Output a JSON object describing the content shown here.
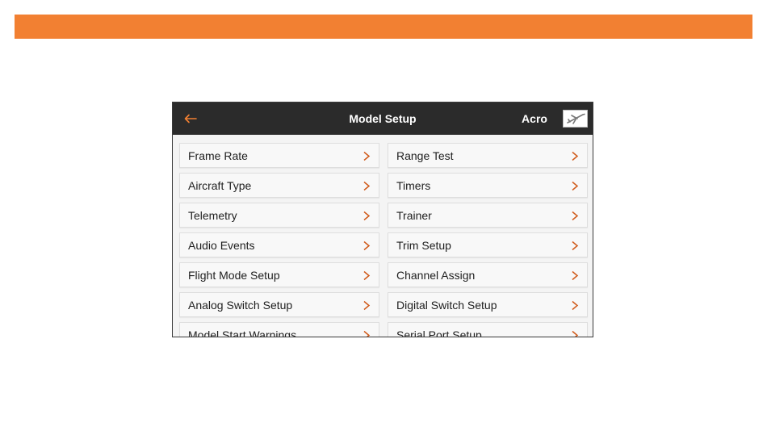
{
  "header": {
    "title": "Model Setup",
    "model_name": "Acro",
    "back_icon": "arrow-left-icon",
    "model_icon": "airplane-icon",
    "accent_color": "#f28032"
  },
  "menu": {
    "left": [
      {
        "label": "Frame Rate"
      },
      {
        "label": "Aircraft Type"
      },
      {
        "label": "Telemetry"
      },
      {
        "label": "Audio Events"
      },
      {
        "label": "Flight Mode Setup"
      },
      {
        "label": "Analog Switch Setup"
      },
      {
        "label": "Model Start Warnings"
      }
    ],
    "right": [
      {
        "label": "Range Test"
      },
      {
        "label": "Timers"
      },
      {
        "label": "Trainer"
      },
      {
        "label": "Trim Setup"
      },
      {
        "label": "Channel Assign"
      },
      {
        "label": "Digital Switch Setup"
      },
      {
        "label": "Serial Port Setup"
      }
    ],
    "chevron_icon": "chevron-right-icon"
  }
}
